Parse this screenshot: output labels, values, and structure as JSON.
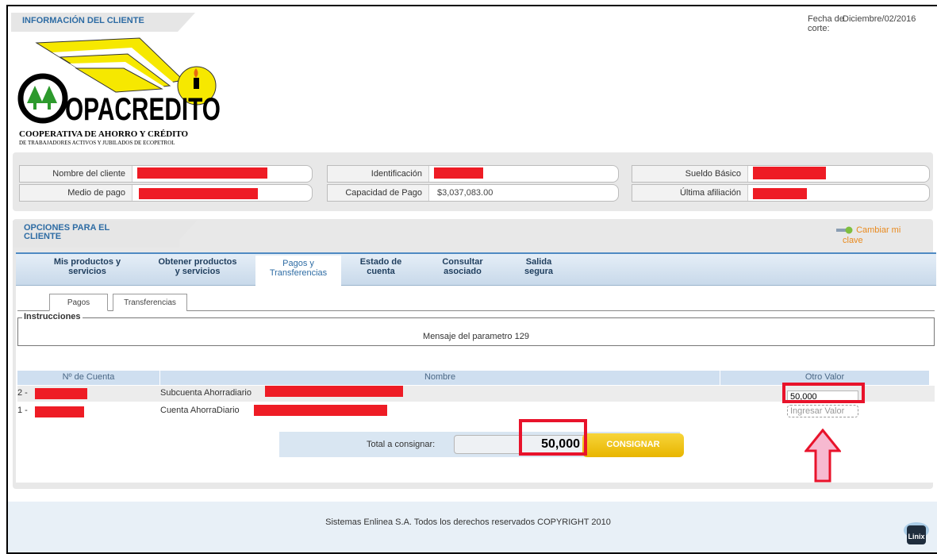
{
  "header": {
    "section_title": "INFORMACIÓN DEL CLIENTE",
    "fecha_corte_label_1": "Fecha de",
    "fecha_corte_label_2": "corte:",
    "fecha_corte_value": "Diciembre/02/2016"
  },
  "logo": {
    "brand": "OPACREDITO",
    "tagline": "COOPERATIVA DE AHORRO Y CRÉDITO",
    "subtagline": "DE TRABAJADORES ACTIVOS Y JUBILADOS DE ECOPETROL"
  },
  "client_info": {
    "nombre_label": "Nombre del cliente",
    "medio_label": "Medio de pago",
    "identificacion_label": "Identificación",
    "capacidad_label": "Capacidad de Pago",
    "capacidad_value": "$3,037,083.00",
    "sueldo_label": "Sueldo Básico",
    "afiliacion_label": "Última afiliación"
  },
  "options": {
    "title_1": "OPCIONES PARA EL",
    "title_2": "CLIENTE",
    "cambiar_clave_1": "Cambiar mi",
    "cambiar_clave_2": "clave"
  },
  "nav": {
    "items": [
      {
        "line1": "Mis productos y",
        "line2": "servicios"
      },
      {
        "line1": "Obtener productos",
        "line2": "y servicios"
      },
      {
        "line1": "Pagos y",
        "line2": "Transferencias"
      },
      {
        "line1": "Estado de",
        "line2": "cuenta"
      },
      {
        "line1": "Consultar",
        "line2": "asociado"
      },
      {
        "line1": "Salida",
        "line2": "segura"
      }
    ]
  },
  "subtabs": {
    "pagos": "Pagos",
    "transferencias": "Transferencias"
  },
  "instrucciones": {
    "legend": "Instrucciones",
    "message": "Mensaje del parametro 129"
  },
  "table": {
    "headers": {
      "cuenta": "Nº de Cuenta",
      "nombre": "Nombre",
      "otro": "Otro Valor"
    },
    "rows": [
      {
        "cuenta_prefix": "2 -",
        "nombre": "Subcuenta Ahorradiario",
        "otro_value": "50,000"
      },
      {
        "cuenta_prefix": "1 -",
        "nombre": "Cuenta AhorraDiario",
        "otro_placeholder": "Ingresar Valor"
      }
    ]
  },
  "total": {
    "label": "Total a consignar:",
    "value": "50,000",
    "button": "CONSIGNAR"
  },
  "footer": {
    "copyright": "Sistemas Enlinea S.A. Todos los derechos reservados COPYRIGHT 2010",
    "logo_text": "Linix"
  },
  "colors": {
    "accent_blue": "#2e6ca4",
    "highlight_red": "#e8132b",
    "button_yellow": "#f2c400",
    "arrow_pink": "#f7b9d0"
  }
}
